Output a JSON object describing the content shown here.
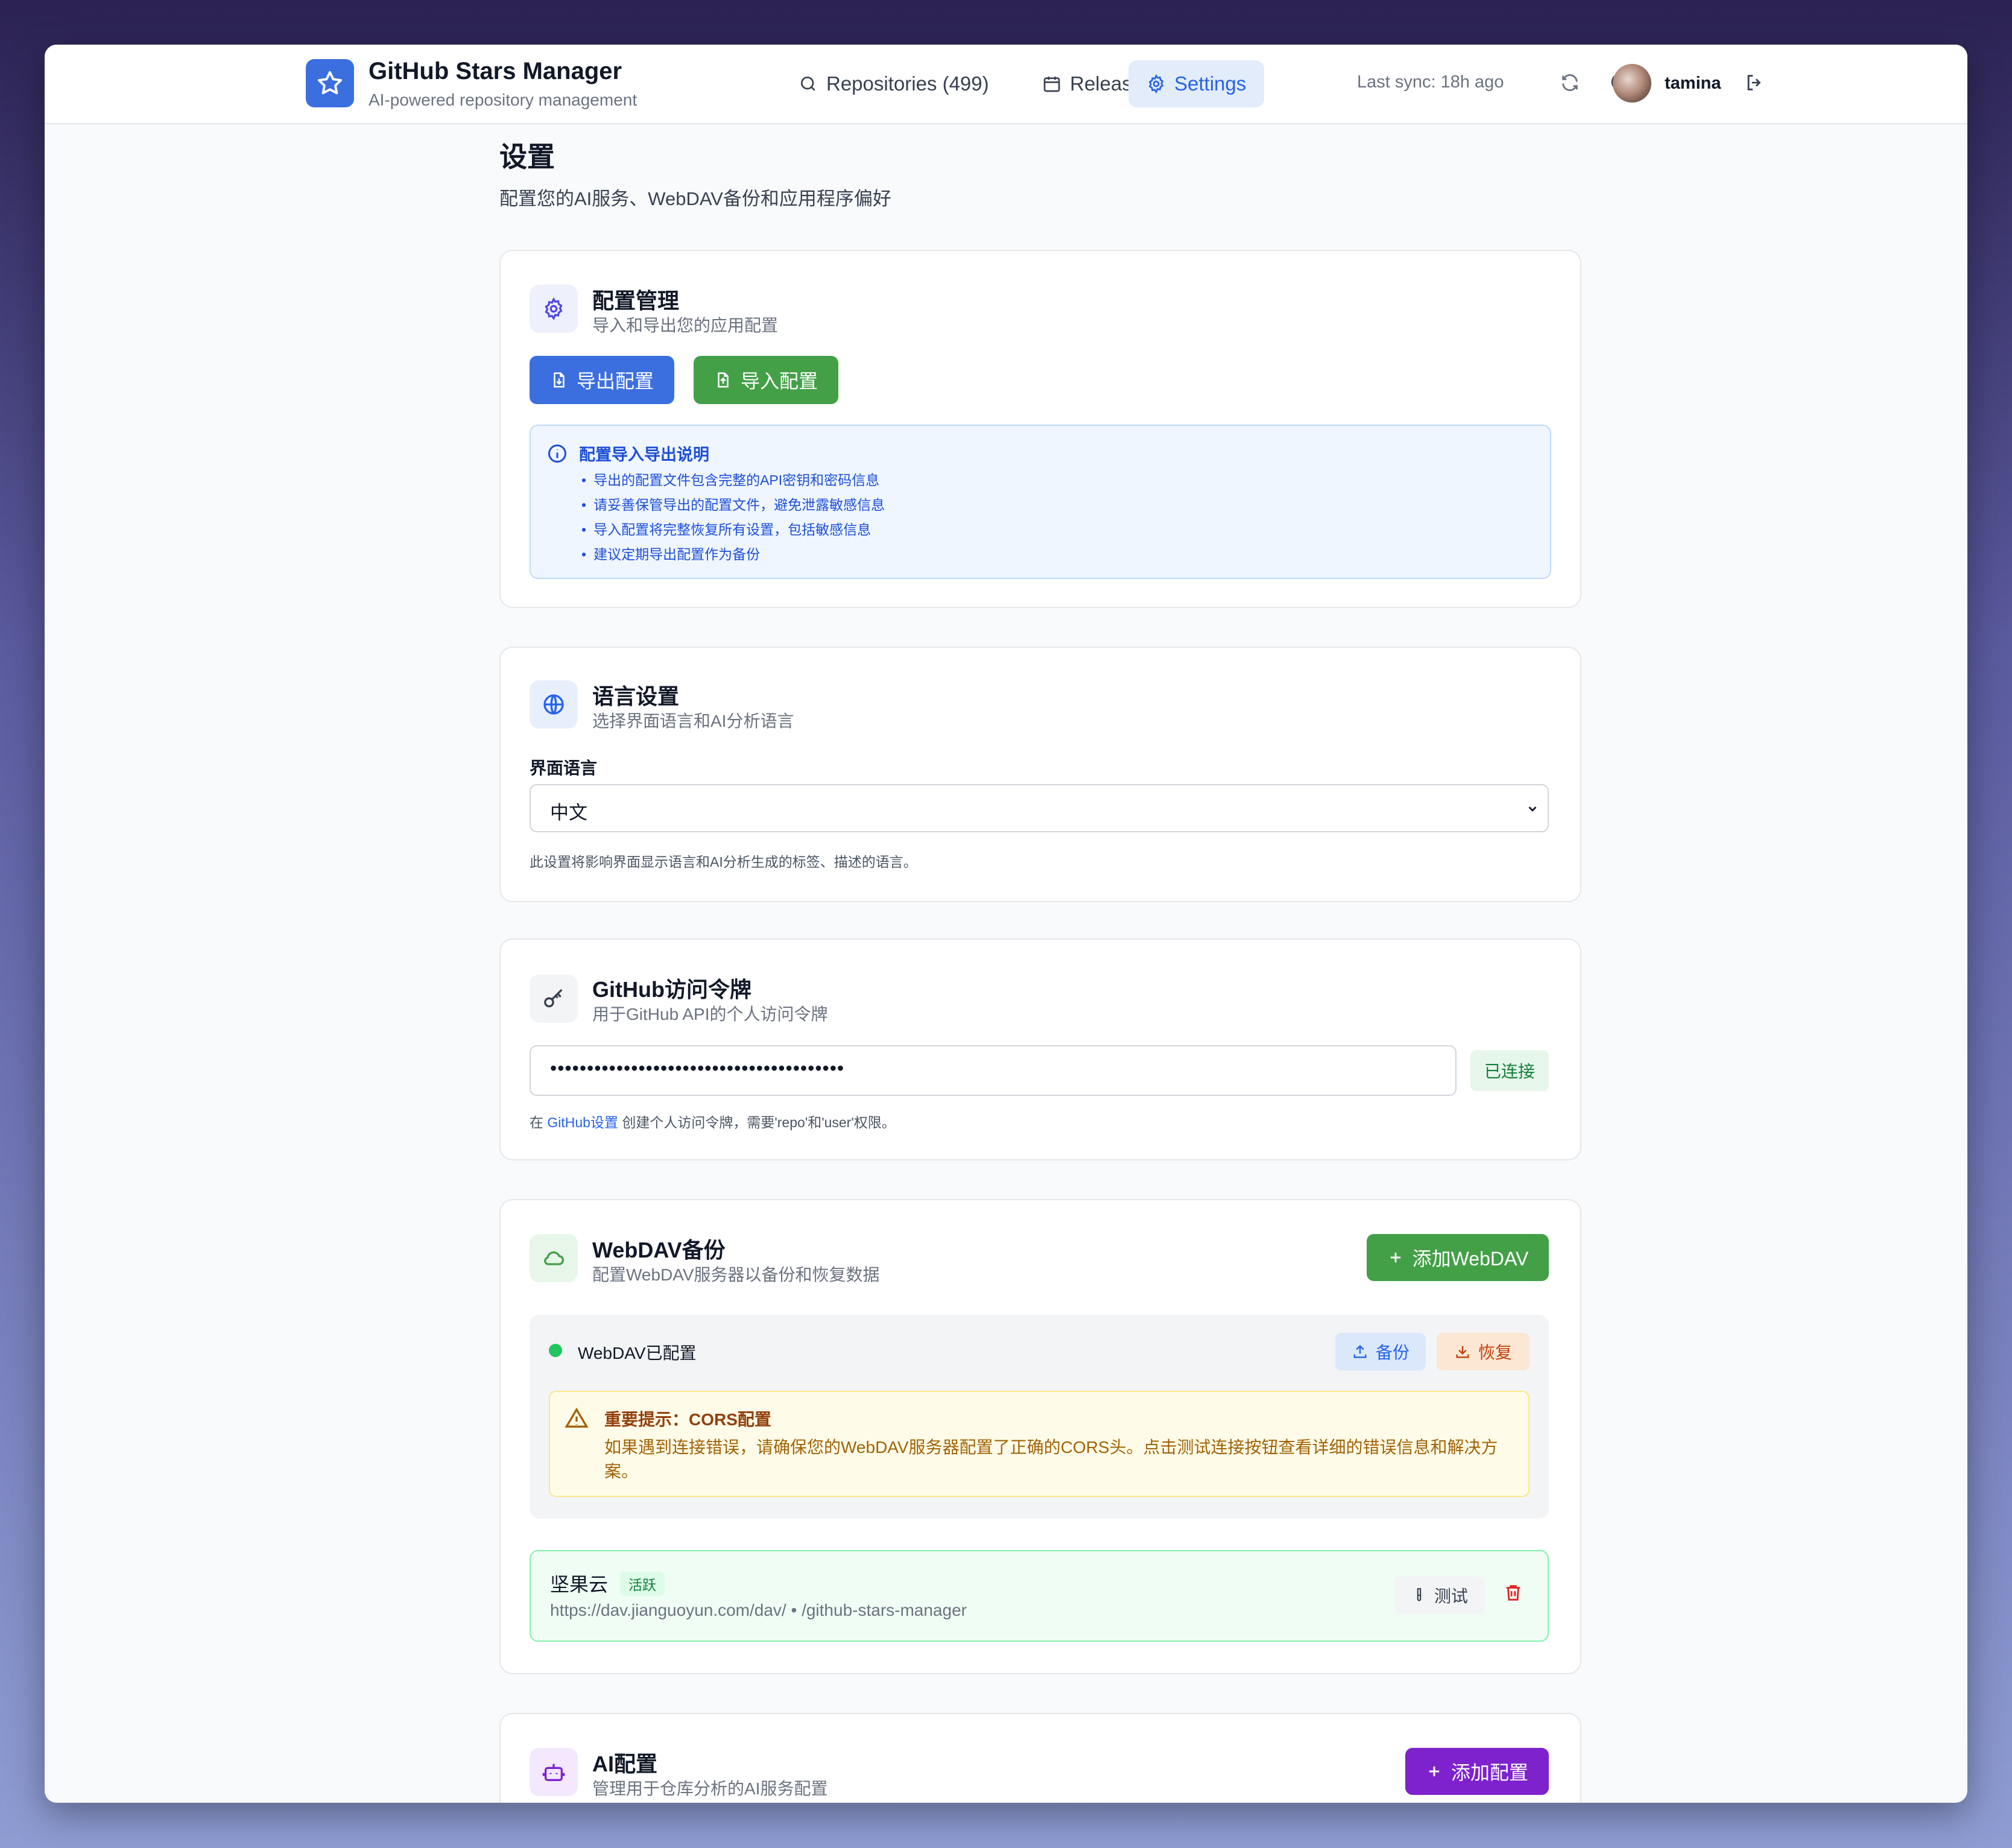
{
  "header": {
    "app_title": "GitHub Stars Manager",
    "app_subtitle": "AI-powered repository management",
    "nav": [
      {
        "label": "Repositories (499)",
        "icon": "search-icon",
        "active": false
      },
      {
        "label": "Releases",
        "icon": "calendar-icon",
        "active": false
      },
      {
        "label": "Settings",
        "icon": "gear-icon",
        "active": true
      }
    ],
    "last_sync": "Last sync: 18h ago",
    "username": "tamina"
  },
  "page": {
    "title": "设置",
    "subtitle": "配置您的AI服务、WebDAV备份和应用程序偏好"
  },
  "config_mgmt": {
    "title": "配置管理",
    "subtitle": "导入和导出您的应用配置",
    "export_label": "导出配置",
    "import_label": "导入配置",
    "info_title": "配置导入导出说明",
    "info_items": [
      "导出的配置文件包含完整的API密钥和密码信息",
      "请妥善保管导出的配置文件，避免泄露敏感信息",
      "导入配置将完整恢复所有设置，包括敏感信息",
      "建议定期导出配置作为备份"
    ]
  },
  "language": {
    "title": "语言设置",
    "subtitle": "选择界面语言和AI分析语言",
    "field_label": "界面语言",
    "selected": "中文",
    "help": "此设置将影响界面显示语言和AI分析生成的标签、描述的语言。"
  },
  "github_token": {
    "title": "GitHub访问令牌",
    "subtitle": "用于GitHub API的个人访问令牌",
    "masked_value": "••••••••••••••••••••••••••••••••••••••••",
    "status": "已连接",
    "help_prefix": "在 ",
    "help_link": "GitHub设置",
    "help_suffix": " 创建个人访问令牌，需要'repo'和'user'权限。"
  },
  "webdav": {
    "title": "WebDAV备份",
    "subtitle": "配置WebDAV服务器以备份和恢复数据",
    "add_label": "添加WebDAV",
    "status": "WebDAV已配置",
    "backup_label": "备份",
    "restore_label": "恢复",
    "warning_title": "重要提示：CORS配置",
    "warning_text": "如果遇到连接错误，请确保您的WebDAV服务器配置了正确的CORS头。点击测试连接按钮查看详细的错误信息和解决方案。",
    "server": {
      "name": "坚果云",
      "badge": "活跃",
      "url": "https://dav.jianguoyun.com/dav/ • /github-stars-manager",
      "test_label": "测试"
    }
  },
  "ai_config": {
    "title": "AI配置",
    "subtitle": "管理用于仓库分析的AI服务配置",
    "add_label": "添加配置"
  },
  "colors": {
    "primary": "#3b6fe0",
    "success": "#43a047",
    "purple": "#7e22ce",
    "active_dot": "#22c55e"
  }
}
